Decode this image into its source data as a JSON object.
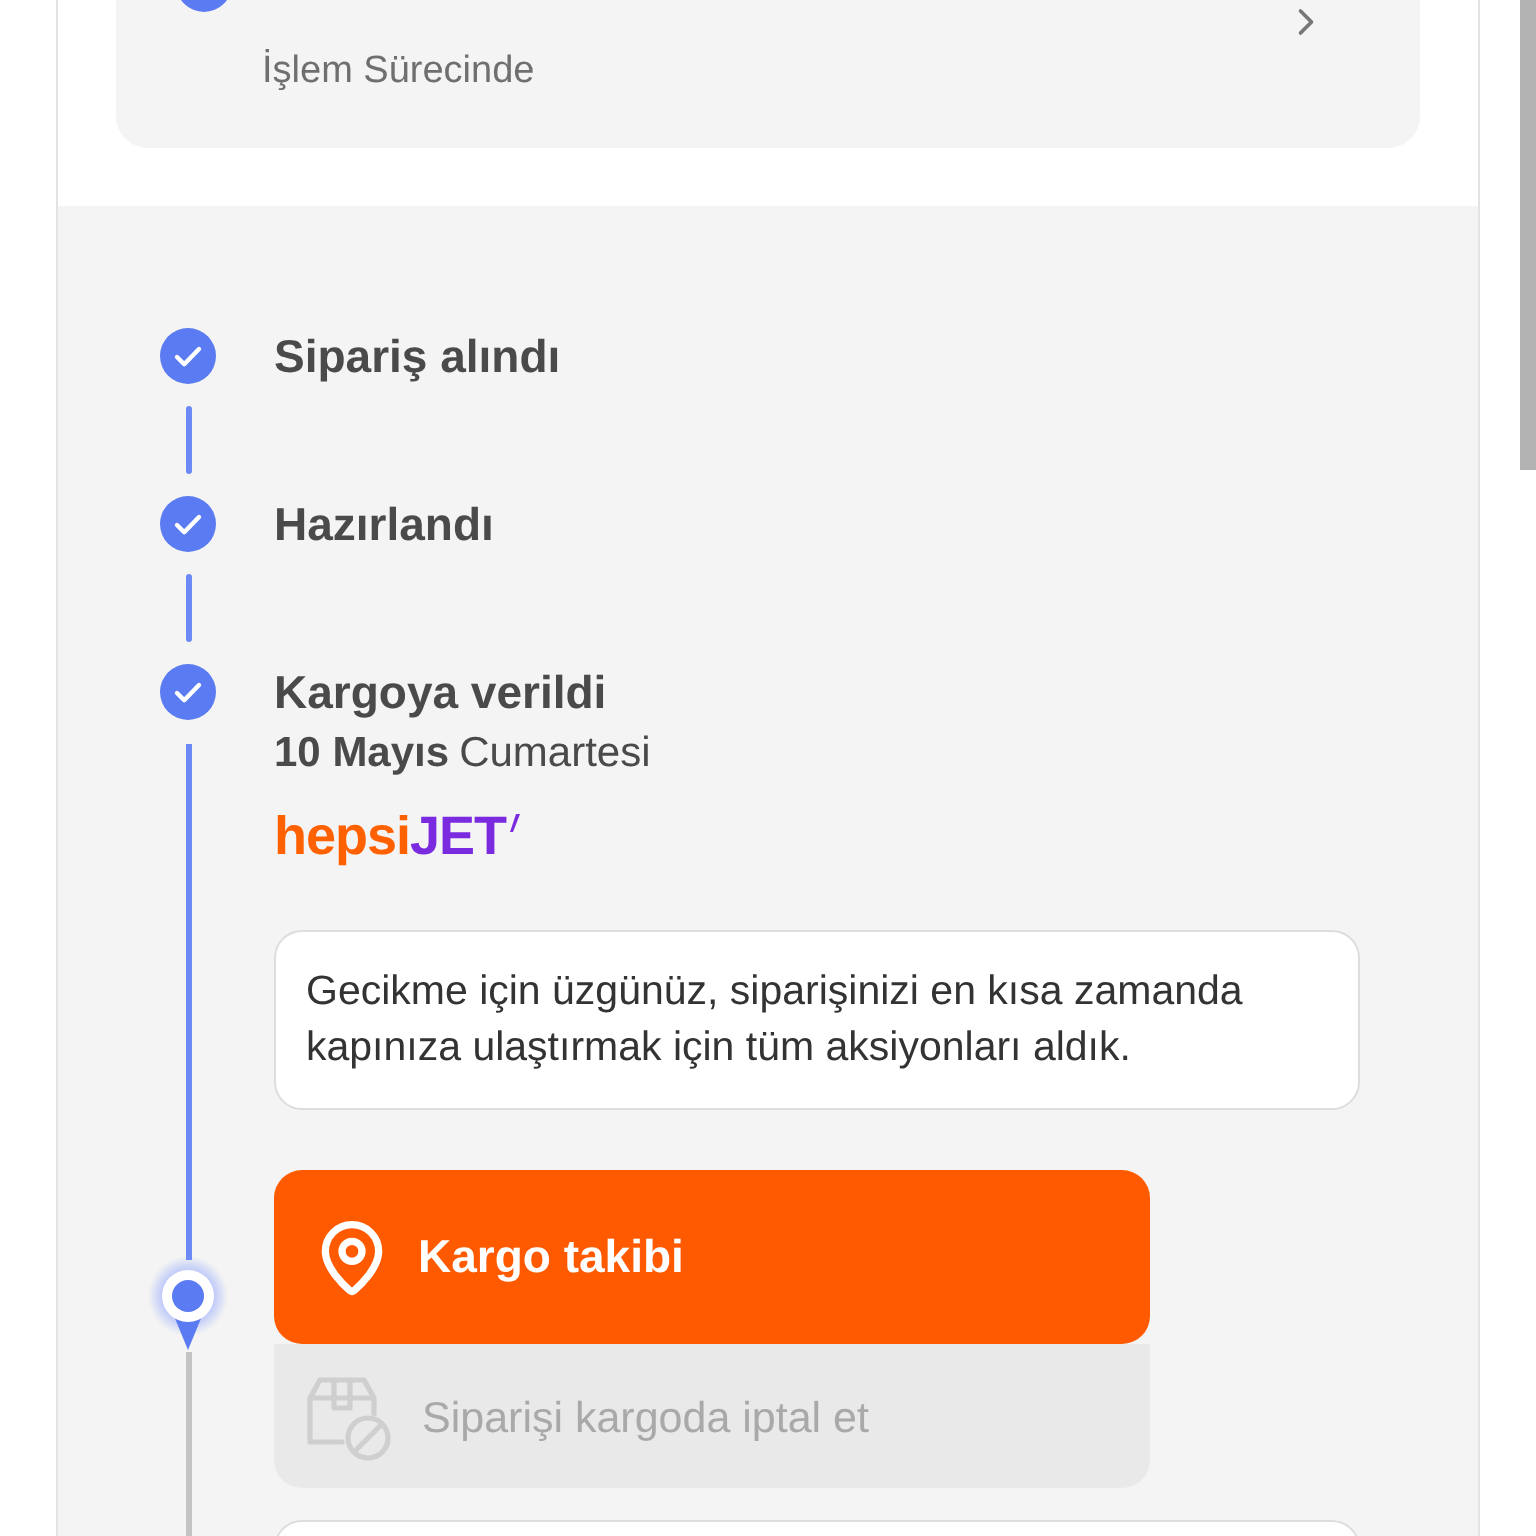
{
  "order_card": {
    "status": "İşlem Sürecinde"
  },
  "steps": [
    {
      "title": "Sipariş alındı",
      "completed": true
    },
    {
      "title": "Hazırlandı",
      "completed": true
    },
    {
      "title": "Kargoya verildi",
      "completed": true,
      "date": "10 Mayıs",
      "weekday": "Cumartesi",
      "carrier_logo": [
        "hepsi",
        "JET"
      ],
      "message": "Gecikme için üzgünüz, siparişinizi en kısa zamanda kapınıza ulaştırmak için tüm aksiyonları aldık.",
      "actions": [
        {
          "label": "Kargo takibi",
          "kind": "track",
          "disabled": false
        },
        {
          "label": "Siparişi kargoda iptal et",
          "kind": "cancel",
          "disabled": true
        }
      ]
    }
  ]
}
